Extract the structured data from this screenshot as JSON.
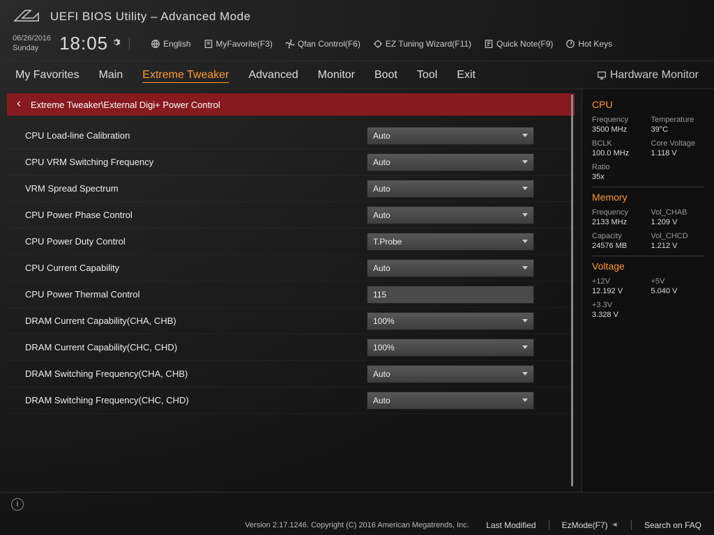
{
  "header": {
    "title": "UEFI BIOS Utility – Advanced Mode",
    "date": "06/26/2016",
    "day": "Sunday",
    "time": "18:05",
    "language": "English",
    "myfavorite": "MyFavorite(F3)",
    "qfan": "Qfan Control(F6)",
    "eztuning": "EZ Tuning Wizard(F11)",
    "quicknote": "Quick Note(F9)",
    "hotkeys": "Hot Keys"
  },
  "tabs": {
    "t0": "My Favorites",
    "t1": "Main",
    "t2": "Extreme Tweaker",
    "t3": "Advanced",
    "t4": "Monitor",
    "t5": "Boot",
    "t6": "Tool",
    "t7": "Exit",
    "hwmon": "Hardware Monitor"
  },
  "breadcrumb": "Extreme Tweaker\\External Digi+ Power Control",
  "rows": [
    {
      "label": "CPU Load-line Calibration",
      "kind": "select",
      "value": "Auto"
    },
    {
      "label": "CPU VRM Switching Frequency",
      "kind": "select",
      "value": "Auto"
    },
    {
      "label": "VRM Spread Spectrum",
      "kind": "select",
      "value": "Auto"
    },
    {
      "label": "CPU Power Phase Control",
      "kind": "select",
      "value": "Auto"
    },
    {
      "label": "CPU Power Duty Control",
      "kind": "select",
      "value": "T.Probe"
    },
    {
      "label": "CPU Current Capability",
      "kind": "select",
      "value": "Auto"
    },
    {
      "label": "CPU Power Thermal Control",
      "kind": "text",
      "value": "115"
    },
    {
      "label": "DRAM Current Capability(CHA, CHB)",
      "kind": "select",
      "value": "100%"
    },
    {
      "label": "DRAM Current Capability(CHC, CHD)",
      "kind": "select",
      "value": "100%"
    },
    {
      "label": "DRAM Switching Frequency(CHA, CHB)",
      "kind": "select",
      "value": "Auto"
    },
    {
      "label": "DRAM Switching Frequency(CHC, CHD)",
      "kind": "select",
      "value": "Auto"
    }
  ],
  "sidebar": {
    "cpu": {
      "title": "CPU",
      "freq_k": "Frequency",
      "freq_v": "3500 MHz",
      "temp_k": "Temperature",
      "temp_v": "39°C",
      "bclk_k": "BCLK",
      "bclk_v": "100.0 MHz",
      "cv_k": "Core Voltage",
      "cv_v": "1.118 V",
      "ratio_k": "Ratio",
      "ratio_v": "35x"
    },
    "memory": {
      "title": "Memory",
      "freq_k": "Frequency",
      "freq_v": "2133 MHz",
      "vab_k": "Vol_CHAB",
      "vab_v": "1.209 V",
      "cap_k": "Capacity",
      "cap_v": "24576 MB",
      "vcd_k": "Vol_CHCD",
      "vcd_v": "1.212 V"
    },
    "voltage": {
      "title": "Voltage",
      "v12_k": "+12V",
      "v12_v": "12.192 V",
      "v5_k": "+5V",
      "v5_v": "5.040 V",
      "v33_k": "+3.3V",
      "v33_v": "3.328 V"
    }
  },
  "footer": {
    "version": "Version 2.17.1246. Copyright (C) 2016 American Megatrends, Inc.",
    "last_modified": "Last Modified",
    "ezmode": "EzMode(F7)",
    "search": "Search on FAQ"
  }
}
